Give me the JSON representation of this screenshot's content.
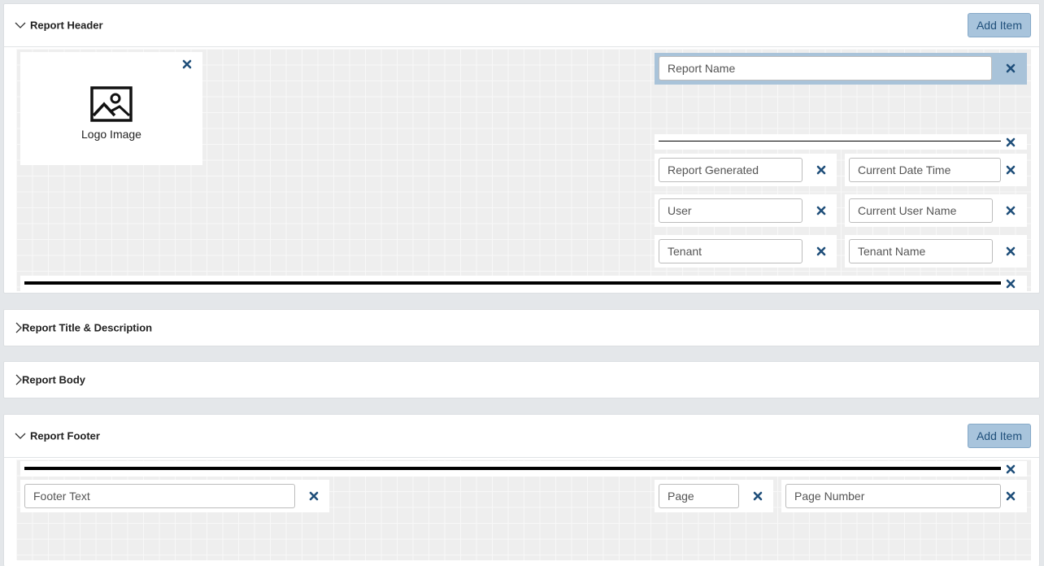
{
  "header": {
    "title": "Report Header",
    "add_label": "Add Item",
    "logo_label": "Logo Image",
    "report_name": "Report Name",
    "generated_label": "Report Generated",
    "generated_value": "Current Date Time",
    "user_label": "User",
    "user_value": "Current User Name",
    "tenant_label": "Tenant",
    "tenant_value": "Tenant Name"
  },
  "title_desc": {
    "title": "Report Title & Description"
  },
  "body_section": {
    "title": "Report Body"
  },
  "footer": {
    "title": "Report Footer",
    "add_label": "Add Item",
    "footer_text": "Footer Text",
    "page_label": "Page",
    "page_value": "Page Number"
  },
  "icons": {
    "remove": "close-icon",
    "expanded": "chevron-down-icon",
    "collapsed": "chevron-right-icon",
    "logo": "image-icon"
  },
  "colors": {
    "accent": "#1f4f7a",
    "button_bg": "#a8c4dc",
    "selected_bg": "#a9c3d9",
    "canvas": "#eeeeee"
  }
}
